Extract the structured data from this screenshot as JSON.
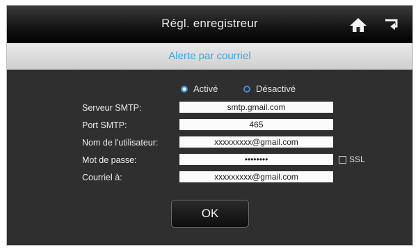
{
  "window": {
    "title": "Régl. enregistreur",
    "icons": {
      "home": "home-icon",
      "return": "return-icon"
    }
  },
  "section": {
    "title": "Alerte par courriel"
  },
  "alert_mode": {
    "options": [
      {
        "label": "Activé",
        "selected": true
      },
      {
        "label": "Désactivé",
        "selected": false
      }
    ]
  },
  "fields": {
    "smtp_server": {
      "label": "Serveur SMTP:",
      "value": "smtp.gmail.com"
    },
    "smtp_port": {
      "label": "Port SMTP:",
      "value": "465"
    },
    "username": {
      "label": "Nom de l'utilisateur:",
      "value": "xxxxxxxxx@gmail.com"
    },
    "password": {
      "label": "Mot de passe:",
      "value": "••••••••"
    },
    "email_to": {
      "label": "Courriel à:",
      "value": "xxxxxxxxx@gmail.com"
    }
  },
  "ssl": {
    "label": "SSL",
    "checked": false
  },
  "actions": {
    "ok_label": "OK"
  },
  "colors": {
    "accent_blue": "#35a7e3",
    "panel_bg": "#2f2f2f"
  }
}
